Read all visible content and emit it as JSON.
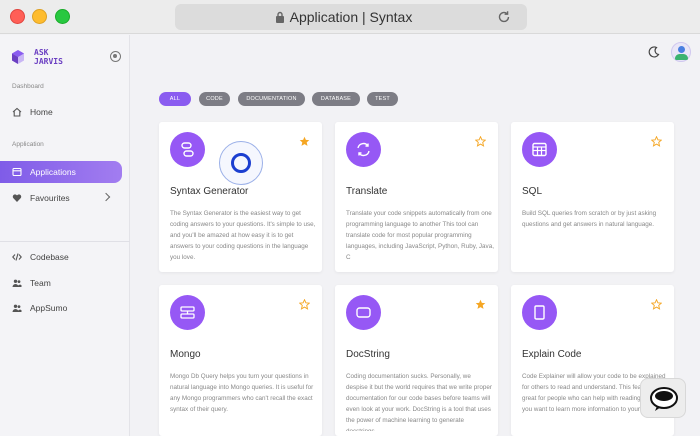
{
  "window": {
    "url_text": "Application | Syntax"
  },
  "sidebar": {
    "logo_text": "ASK\nJARVIS",
    "sections": {
      "dashboard": "Dashboard",
      "application": "Application"
    },
    "items": [
      {
        "label": "Home",
        "icon": "home-icon"
      },
      {
        "label": "Applications",
        "icon": "window-icon"
      },
      {
        "label": "Favourites",
        "icon": "heart-icon"
      },
      {
        "label": "Codebase",
        "icon": "code-icon"
      },
      {
        "label": "Team",
        "icon": "team-icon"
      },
      {
        "label": "AppSumo",
        "icon": "team-icon"
      }
    ]
  },
  "filters": [
    "ALL",
    "CODE",
    "DOCUMENTATION",
    "DATABASE",
    "TEST"
  ],
  "cards": [
    {
      "title": "Syntax Generator",
      "starred": true,
      "desc": "The Syntax Generator is the easiest way to get coding answers to your questions. It's simple to use, and you'll be amazed at how easy it is to get answers to your coding questions in the language you love."
    },
    {
      "title": "Translate",
      "starred": false,
      "desc": "Translate your code snippets automatically from one programming language to another This tool can translate code for most popular programming languages, including JavaScript, Python, Ruby, Java, C"
    },
    {
      "title": "SQL",
      "starred": false,
      "desc": "Build SQL queries from scratch or by just asking questions and get answers in natural language."
    },
    {
      "title": "Mongo",
      "starred": false,
      "desc": "Mongo Db Query helps you turn your questions in natural language into Mongo queries. It is useful for any Mongo programmers who can't recall the exact syntax of their query."
    },
    {
      "title": "DocString",
      "starred": true,
      "desc": "Coding documentation sucks. Personally, we despise it but the world requires that we write proper documentation for our code bases before teams will even look at your work. DocString is a tool that uses the power of machine learning to generate docstrings"
    },
    {
      "title": "Explain Code",
      "starred": false,
      "desc": "Code Explainer will allow your code to be explained for others to read and understand. This feature is great for people who can help with reading code or if you want to learn more information to your code."
    }
  ],
  "colors": {
    "accent": "#8a5cf0",
    "star": "#f5a623",
    "chip": "#7d7d85"
  }
}
